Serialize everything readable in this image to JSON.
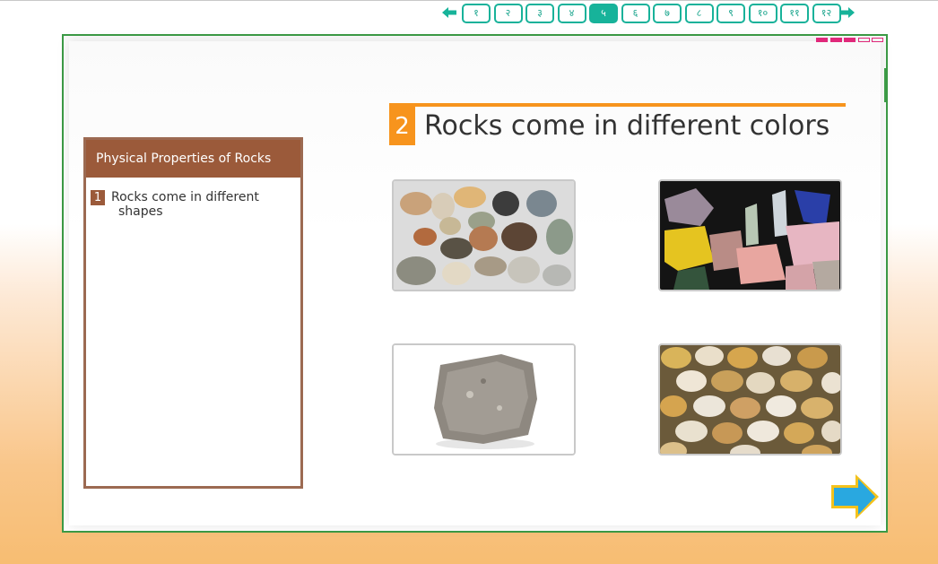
{
  "nav": {
    "pages": [
      "१",
      "२",
      "३",
      "४",
      "५",
      "६",
      "७",
      "८",
      "९",
      "१०",
      "११",
      "१२"
    ],
    "active_index": 4,
    "prev_icon": "arrow-left-icon",
    "next_icon": "arrow-right-icon"
  },
  "progress": {
    "total": 5,
    "completed": 3,
    "color": "#e0287a"
  },
  "sidebar": {
    "title": "Physical Properties of Rocks",
    "items": [
      {
        "number": "1",
        "line1": "Rocks come in different",
        "line2": "shapes"
      }
    ]
  },
  "slide": {
    "number": "2",
    "title": "Rocks come in different colors"
  },
  "images": [
    {
      "name": "assorted-pebbles-image",
      "subject": "assorted colored pebbles"
    },
    {
      "name": "mineral-crystals-image",
      "subject": "colorful mineral crystals"
    },
    {
      "name": "gray-rock-image",
      "subject": "single gray rock"
    },
    {
      "name": "river-stones-image",
      "subject": "yellow and white river stones"
    }
  ],
  "next_button": {
    "icon": "arrow-right-icon"
  },
  "colors": {
    "accent_orange": "#f7941d",
    "panel_brown": "#9b5a3a",
    "nav_teal": "#17b39a",
    "frame_green": "#3c9b46",
    "next_blue": "#29a8e0"
  }
}
